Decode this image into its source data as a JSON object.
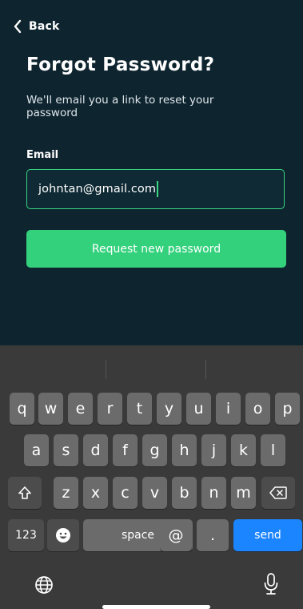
{
  "nav": {
    "back_label": "Back"
  },
  "page": {
    "title": "Forgot Password?",
    "subtitle": "We'll email you a link to reset your password"
  },
  "form": {
    "email_label": "Email",
    "email_value": "johntan@gmail.com",
    "submit_label": "Request new password"
  },
  "colors": {
    "background": "#0e2530",
    "accent": "#34d17d",
    "keyboard": "#3a3a3a",
    "send": "#1b84ff"
  },
  "keyboard": {
    "row1": [
      "q",
      "w",
      "e",
      "r",
      "t",
      "y",
      "u",
      "i",
      "o",
      "p"
    ],
    "row2": [
      "a",
      "s",
      "d",
      "f",
      "g",
      "h",
      "j",
      "k",
      "l"
    ],
    "row3": [
      "z",
      "x",
      "c",
      "v",
      "b",
      "n",
      "m"
    ],
    "numbers_label": "123",
    "space_label": "space",
    "at_label": "@",
    "dot_label": ".",
    "send_label": "send",
    "icons": [
      "shift-icon",
      "backspace-icon",
      "emoji-icon",
      "globe-icon",
      "microphone-icon"
    ]
  }
}
